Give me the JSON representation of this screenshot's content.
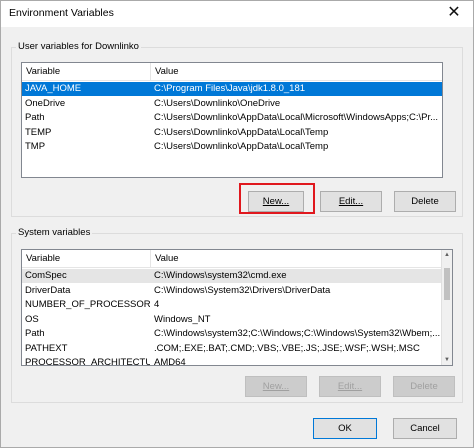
{
  "window": {
    "title": "Environment Variables",
    "close_glyph": "✕"
  },
  "user": {
    "group_label": "User variables for Downlinko",
    "col_variable": "Variable",
    "col_value": "Value",
    "rows": [
      {
        "name": "JAVA_HOME",
        "value": "C:\\Program Files\\Java\\jdk1.8.0_181",
        "selected": true
      },
      {
        "name": "OneDrive",
        "value": "C:\\Users\\Downlinko\\OneDrive"
      },
      {
        "name": "Path",
        "value": "C:\\Users\\Downlinko\\AppData\\Local\\Microsoft\\WindowsApps;C:\\Pr..."
      },
      {
        "name": "TEMP",
        "value": "C:\\Users\\Downlinko\\AppData\\Local\\Temp"
      },
      {
        "name": "TMP",
        "value": "C:\\Users\\Downlinko\\AppData\\Local\\Temp"
      }
    ],
    "buttons": {
      "new": "New...",
      "edit": "Edit...",
      "delete": "Delete"
    }
  },
  "system": {
    "group_label": "System variables",
    "col_variable": "Variable",
    "col_value": "Value",
    "rows": [
      {
        "name": "ComSpec",
        "value": "C:\\Windows\\system32\\cmd.exe",
        "highlight": true
      },
      {
        "name": "DriverData",
        "value": "C:\\Windows\\System32\\Drivers\\DriverData"
      },
      {
        "name": "NUMBER_OF_PROCESSORS",
        "value": "4"
      },
      {
        "name": "OS",
        "value": "Windows_NT"
      },
      {
        "name": "Path",
        "value": "C:\\Windows\\system32;C:\\Windows;C:\\Windows\\System32\\Wbem;..."
      },
      {
        "name": "PATHEXT",
        "value": ".COM;.EXE;.BAT;.CMD;.VBS;.VBE;.JS;.JSE;.WSF;.WSH;.MSC"
      },
      {
        "name": "PROCESSOR_ARCHITECTURE",
        "value": "AMD64"
      }
    ],
    "buttons": {
      "new": "New...",
      "edit": "Edit...",
      "delete": "Delete"
    }
  },
  "footer": {
    "ok": "OK",
    "cancel": "Cancel"
  },
  "colors": {
    "selection": "#0078d7",
    "annotation": "#e0181e"
  }
}
